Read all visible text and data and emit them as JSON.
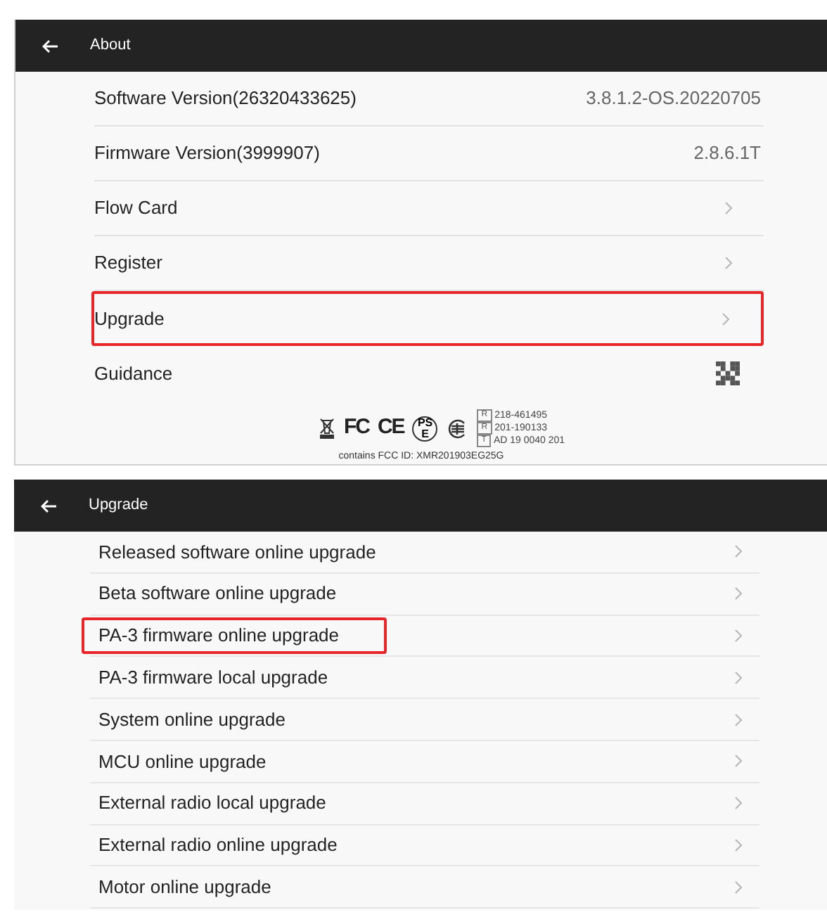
{
  "about": {
    "title": "About",
    "rows": [
      {
        "kind": "value",
        "label": "Software Version(26320433625)",
        "value": "3.8.1.2-OS.20220705",
        "highlighted": false
      },
      {
        "kind": "value",
        "label": "Firmware Version(3999907)",
        "value": "2.8.6.1T",
        "highlighted": false
      },
      {
        "kind": "link",
        "label": "Flow Card",
        "highlighted": false
      },
      {
        "kind": "link",
        "label": "Register",
        "highlighted": false
      },
      {
        "kind": "link",
        "label": "Upgrade",
        "highlighted": true
      },
      {
        "kind": "qr",
        "label": "Guidance",
        "highlighted": false
      }
    ],
    "certification": {
      "marks": [
        "FC",
        "CE",
        "PS E"
      ],
      "registrations": [
        {
          "prefix": "R",
          "number": "218-461495"
        },
        {
          "prefix": "R",
          "number": "201-190133"
        },
        {
          "prefix": "T",
          "number": "AD 19 0040 201"
        }
      ],
      "fcc_id": "contains FCC ID: XMR201903EG25G"
    }
  },
  "upgrade": {
    "title": "Upgrade",
    "rows": [
      {
        "label": "Released software online upgrade",
        "highlighted": false
      },
      {
        "label": "Beta software online upgrade",
        "highlighted": false
      },
      {
        "label": "PA-3 firmware online upgrade",
        "highlighted": true
      },
      {
        "label": "PA-3 firmware local upgrade",
        "highlighted": false
      },
      {
        "label": "System online upgrade",
        "highlighted": false
      },
      {
        "label": "MCU online upgrade",
        "highlighted": false
      },
      {
        "label": "External radio local upgrade",
        "highlighted": false
      },
      {
        "label": "External radio online upgrade",
        "highlighted": false
      },
      {
        "label": "Motor online upgrade",
        "highlighted": false
      }
    ]
  }
}
